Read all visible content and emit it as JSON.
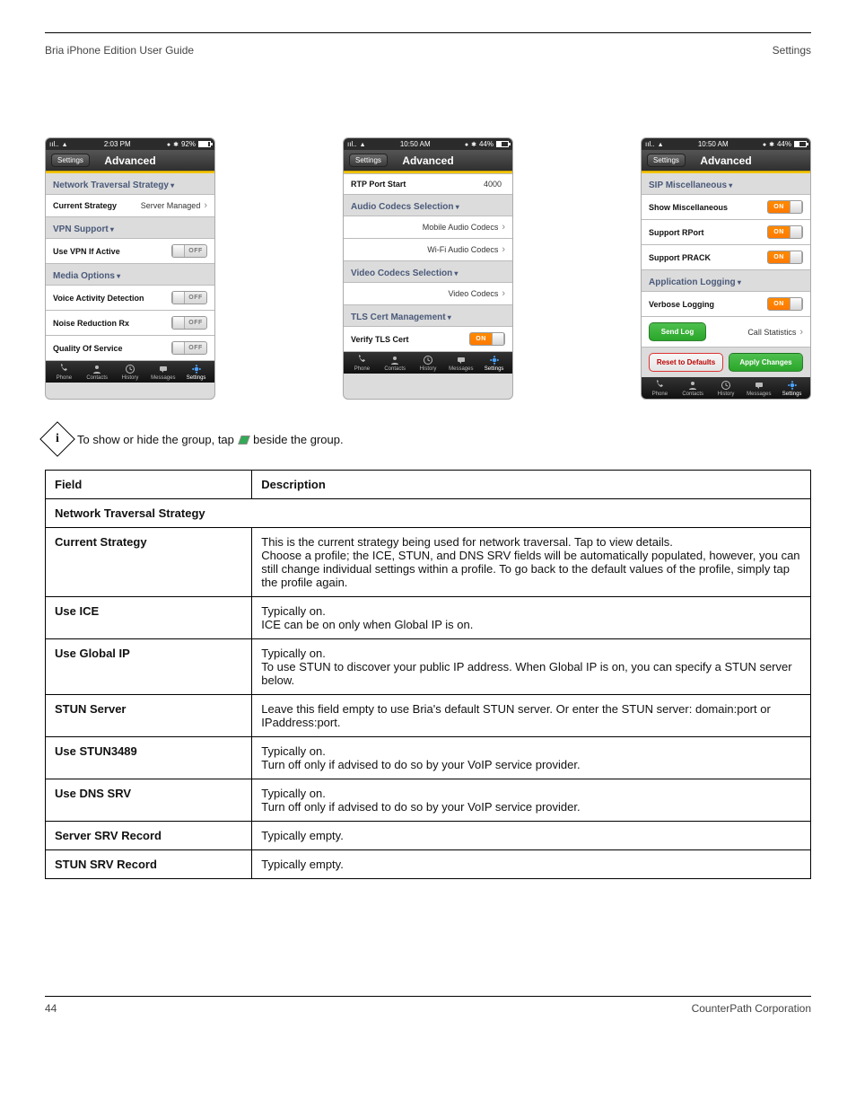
{
  "header": {
    "title": "Bria iPhone Edition User Guide",
    "sub": "Settings"
  },
  "footer": {
    "page": "44",
    "right": "CounterPath Corporation"
  },
  "info_text_before": "To show or hide the group, tap ",
  "info_icon_char": ".",
  "info_text_after": " beside the group.",
  "table": {
    "head": [
      "Field",
      "Description"
    ],
    "section1": {
      "title": "Network Traversal Strategy"
    },
    "rows": [
      {
        "field": "Current Strategy",
        "desc_lines": [
          "This is the current strategy being used for network traversal. Tap to view details.",
          "Choose a profile; the ICE, STUN, and DNS SRV fields will be automatically populated, however, you can still change individual settings within a profile. To go back to the default values of the profile, simply tap the profile again."
        ]
      },
      {
        "field": "Use ICE",
        "desc_lines": [
          "Typically on.",
          "ICE can be on only when Global IP is on."
        ]
      },
      {
        "field": "Use Global IP",
        "desc_lines": [
          "Typically on.",
          "To use STUN to discover your public IP address. When Global IP is on, you can specify a STUN server below."
        ]
      },
      {
        "field": "STUN Server",
        "desc_lines": [
          "Leave this field empty to use Bria's default STUN server. Or enter the STUN server: domain:port or IPaddress:port."
        ]
      },
      {
        "field": "Use STUN3489",
        "desc_lines": [
          "Typically on.",
          "Turn off only if advised to do so by your VoIP service provider."
        ]
      },
      {
        "field": "Use DNS SRV",
        "desc_lines": [
          "Typically on.",
          "Turn off only if advised to do so by your VoIP service provider."
        ]
      },
      {
        "field": "Server SRV Record",
        "desc_lines": [
          "Typically empty."
        ]
      },
      {
        "field": "STUN SRV Record",
        "desc_lines": [
          "Typically empty."
        ]
      }
    ]
  },
  "screens": [
    {
      "status": {
        "time": "2:03 PM",
        "batt_pct": "92%",
        "batt_fill": 80
      },
      "nav": {
        "back": "Settings",
        "title": "Advanced"
      },
      "groups": [
        {
          "header": "Network Traversal Strategy",
          "items": [
            {
              "type": "nav",
              "label": "Current Strategy",
              "value": "Server Managed"
            }
          ]
        },
        {
          "header": "VPN Support",
          "items": [
            {
              "type": "toggle",
              "label": "Use VPN If Active",
              "state": "OFF"
            }
          ]
        },
        {
          "header": "Media Options",
          "items": [
            {
              "type": "toggle",
              "label": "Voice Activity Detection",
              "state": "OFF"
            },
            {
              "type": "toggle",
              "label": "Noise Reduction Rx",
              "state": "OFF"
            },
            {
              "type": "toggle",
              "label": "Quality Of Service",
              "state": "OFF"
            }
          ]
        }
      ]
    },
    {
      "status": {
        "time": "10:50 AM",
        "batt_pct": "44%",
        "batt_fill": 40
      },
      "nav": {
        "back": "Settings",
        "title": "Advanced"
      },
      "groups": [
        {
          "header": null,
          "items": [
            {
              "type": "value",
              "label": "RTP Port Start",
              "value": "4000"
            }
          ]
        },
        {
          "header": "Audio Codecs Selection",
          "items": [
            {
              "type": "nav",
              "label": "",
              "value": "Mobile Audio Codecs"
            },
            {
              "type": "nav",
              "label": "",
              "value": "Wi-Fi Audio Codecs"
            }
          ]
        },
        {
          "header": "Video Codecs Selection",
          "items": [
            {
              "type": "nav",
              "label": "",
              "value": "Video Codecs"
            }
          ]
        },
        {
          "header": "TLS Cert Management",
          "items": [
            {
              "type": "toggle",
              "label": "Verify TLS Cert",
              "state": "ON"
            }
          ]
        }
      ]
    },
    {
      "status": {
        "time": "10:50 AM",
        "batt_pct": "44%",
        "batt_fill": 40
      },
      "nav": {
        "back": "Settings",
        "title": "Advanced"
      },
      "groups": [
        {
          "header": "SIP Miscellaneous",
          "items": [
            {
              "type": "toggle",
              "label": "Show Miscellaneous",
              "state": "ON"
            },
            {
              "type": "toggle",
              "label": "Support RPort",
              "state": "ON"
            },
            {
              "type": "toggle",
              "label": "Support PRACK",
              "state": "ON"
            }
          ]
        },
        {
          "header": "Application Logging",
          "items": [
            {
              "type": "toggle",
              "label": "Verbose Logging",
              "state": "ON"
            }
          ]
        }
      ],
      "log_row": {
        "send": "Send Log",
        "stats": "Call Statistics"
      },
      "bottom_buttons": {
        "reset": "Reset to Defaults",
        "apply": "Apply Changes"
      }
    }
  ],
  "tabs": [
    "Phone",
    "Contacts",
    "History",
    "Messages",
    "Settings"
  ]
}
